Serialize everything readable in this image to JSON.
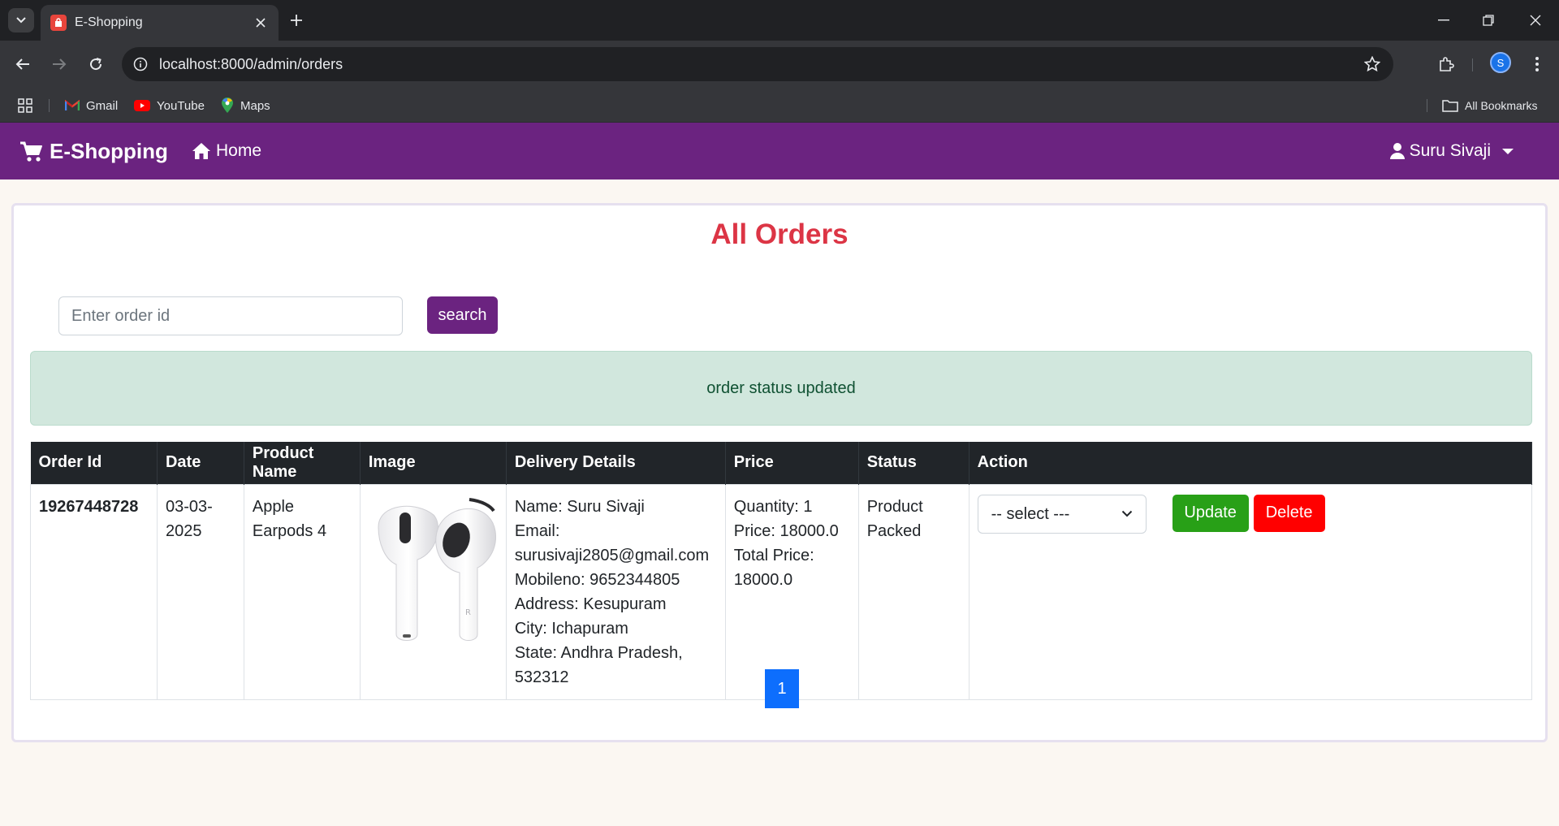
{
  "browser": {
    "tab_title": "E-Shopping",
    "url": "localhost:8000/admin/orders",
    "profile_initial": "S",
    "bookmarks": [
      {
        "label": "Gmail",
        "icon": "gmail-icon"
      },
      {
        "label": "YouTube",
        "icon": "youtube-icon"
      },
      {
        "label": "Maps",
        "icon": "maps-icon"
      }
    ],
    "all_bookmarks": "All Bookmarks"
  },
  "site": {
    "brand": "E-Shopping",
    "home": "Home",
    "user": "Suru Sivaji",
    "accent": "#6b2380"
  },
  "main": {
    "title": "All Orders",
    "search_placeholder": "Enter order id",
    "search_button": "search",
    "alert": "order status updated",
    "columns": [
      "Order Id",
      "Date",
      "Product Name",
      "Image",
      "Delivery Details",
      "Price",
      "Status",
      "Action"
    ],
    "orders": [
      {
        "order_id": "19267448728",
        "date": "03-03-2025",
        "product_name": "Apple Earpods 4",
        "delivery": [
          "Name: Suru Sivaji",
          "Email: surusivaji2805@gmail.com",
          "Mobileno: 9652344805",
          "Address: Kesupuram",
          "City: Ichapuram",
          "State: Andhra Pradesh, 532312"
        ],
        "price": [
          "Quantity: 1",
          "Price: 18000.0",
          "Total Price: 18000.0"
        ],
        "status": "Product Packed",
        "select_value": "-- select ---",
        "update": "Update",
        "delete": "Delete"
      }
    ],
    "page": "1"
  }
}
